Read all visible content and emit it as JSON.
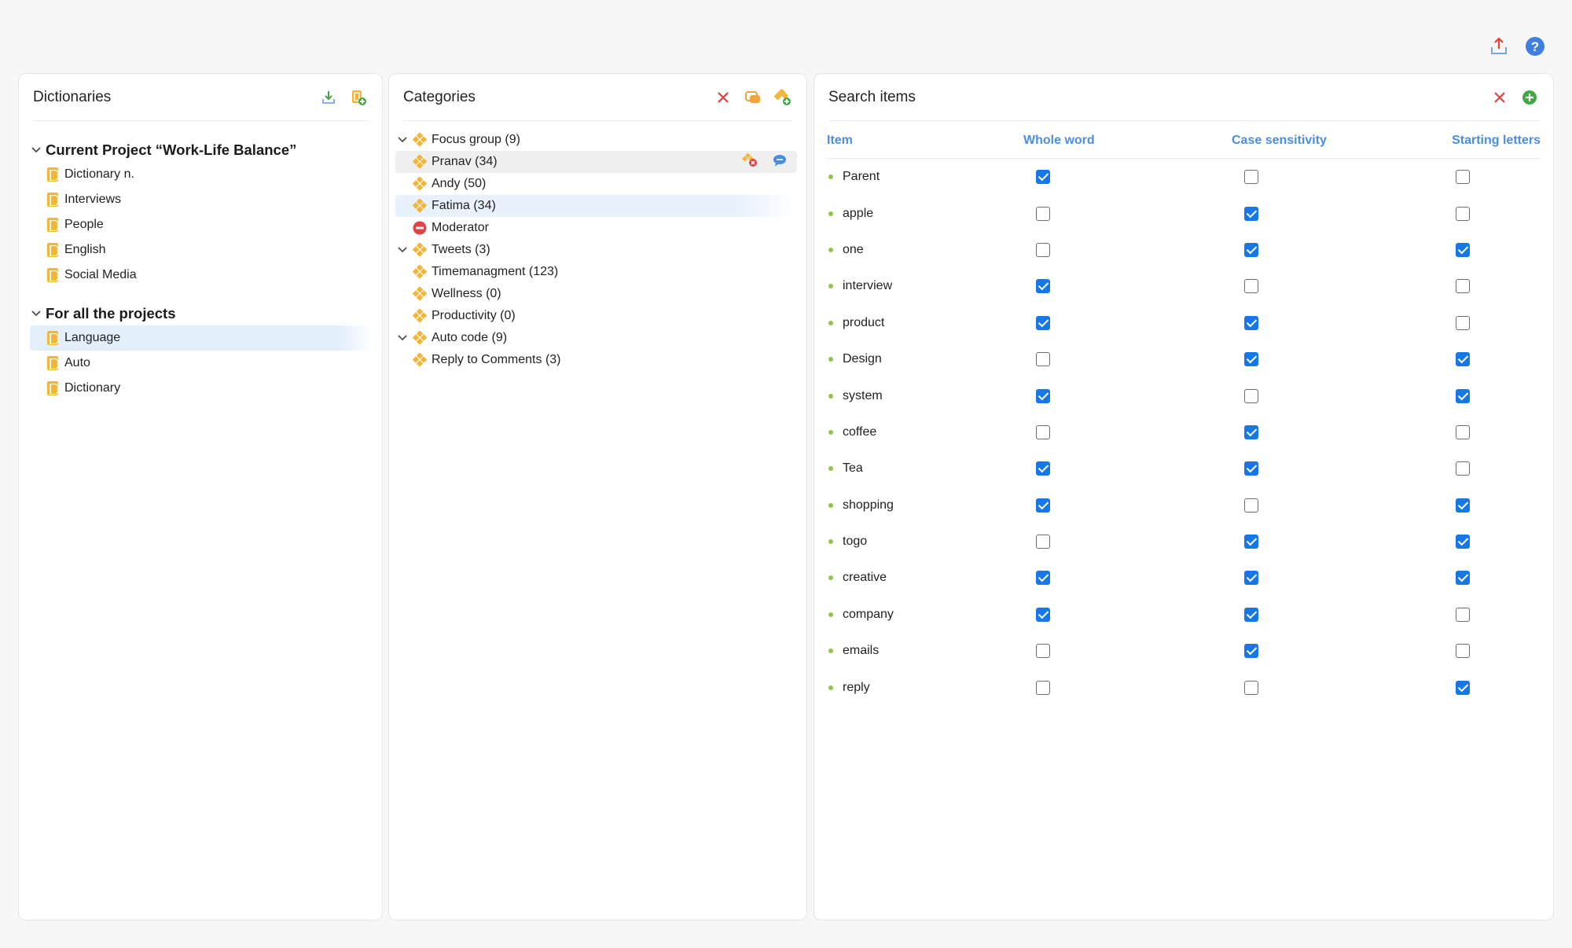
{
  "colors": {
    "accent": "#4a8ee0",
    "checkbox": "#1677e8",
    "folder": "#f3b63c",
    "danger": "#e04343",
    "add": "#43a843"
  },
  "topbar": {
    "export_icon": "export-upload-icon",
    "help_icon": "help-icon"
  },
  "dictionaries": {
    "title": "Dictionaries",
    "groups": [
      {
        "label": "Current Project “Work-Life Balance”",
        "items": [
          "Dictionary n.",
          "Interviews",
          "People",
          "English",
          "Social Media"
        ]
      },
      {
        "label": "For all the projects",
        "items": [
          "Language",
          "Auto",
          "Dictionary"
        ]
      }
    ]
  },
  "categories": {
    "title": "Categories",
    "rows": [
      {
        "label": "Focus group (9)",
        "level": 0,
        "icon": "category-icon"
      },
      {
        "label": "Pranav (34)",
        "level": 1,
        "icon": "category-icon"
      },
      {
        "label": "Andy (50)",
        "level": 1,
        "icon": "category-icon"
      },
      {
        "label": "Fatima (34)",
        "level": 1,
        "icon": "category-icon"
      },
      {
        "label": "Moderator",
        "level": 1,
        "icon": "minus-circle-icon"
      },
      {
        "label": "Tweets (3)",
        "level": 0,
        "icon": "category-icon"
      },
      {
        "label": "Timemanagment (123)",
        "level": 1,
        "icon": "category-icon"
      },
      {
        "label": "Wellness (0)",
        "level": 1,
        "icon": "category-icon"
      },
      {
        "label": "Productivity (0)",
        "level": 1,
        "icon": "category-icon"
      },
      {
        "label": "Auto code (9)",
        "level": 0,
        "icon": "category-icon"
      },
      {
        "label": "Reply to Comments (3)",
        "level": 1,
        "icon": "category-icon"
      }
    ]
  },
  "search_items": {
    "title": "Search items",
    "columns": [
      "Item",
      "Whole word",
      "Case sensitivity",
      "Starting letters"
    ],
    "rows": [
      {
        "item": "Parent",
        "whole": true,
        "case": false,
        "start": false
      },
      {
        "item": "apple",
        "whole": false,
        "case": true,
        "start": false
      },
      {
        "item": "one",
        "whole": false,
        "case": true,
        "start": true
      },
      {
        "item": "interview",
        "whole": true,
        "case": false,
        "start": false
      },
      {
        "item": "product",
        "whole": true,
        "case": true,
        "start": false
      },
      {
        "item": "Design",
        "whole": false,
        "case": true,
        "start": true
      },
      {
        "item": "system",
        "whole": true,
        "case": false,
        "start": true
      },
      {
        "item": "coffee",
        "whole": false,
        "case": true,
        "start": false
      },
      {
        "item": "Tea",
        "whole": true,
        "case": true,
        "start": false
      },
      {
        "item": "shopping",
        "whole": true,
        "case": false,
        "start": true
      },
      {
        "item": "togo",
        "whole": false,
        "case": true,
        "start": true
      },
      {
        "item": "creative",
        "whole": true,
        "case": true,
        "start": true
      },
      {
        "item": "company",
        "whole": true,
        "case": true,
        "start": false
      },
      {
        "item": "emails",
        "whole": false,
        "case": true,
        "start": false
      },
      {
        "item": "reply",
        "whole": false,
        "case": false,
        "start": true
      }
    ]
  }
}
